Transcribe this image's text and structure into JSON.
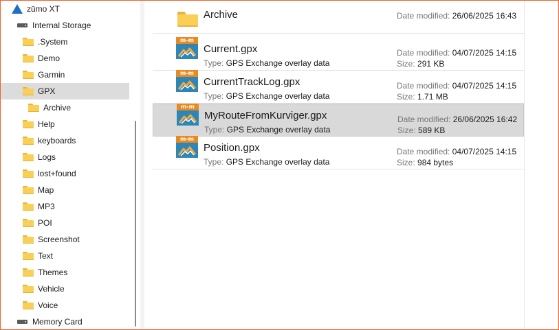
{
  "nav": {
    "device": "zūmo XT",
    "internal_storage": "Internal Storage",
    "folders": [
      ".System",
      "Demo",
      "Garmin",
      "GPX",
      "Help",
      "keyboards",
      "Logs",
      "lost+found",
      "Map",
      "MP3",
      "POI",
      "Screenshot",
      "Text",
      "Themes",
      "Vehicle",
      "Voice"
    ],
    "gpx_child": "Archive",
    "memory_card": "Memory Card",
    "selected": "GPX"
  },
  "files": [
    {
      "name": "Archive",
      "is_folder": true,
      "type_label": "",
      "type": "",
      "date_label": "Date modified:",
      "date": "26/06/2025 16:43",
      "size_label": "",
      "size": ""
    },
    {
      "name": "Current.gpx",
      "is_folder": false,
      "type_label": "Type:",
      "type": "GPS Exchange overlay data",
      "date_label": "Date modified:",
      "date": "04/07/2025 14:15",
      "size_label": "Size:",
      "size": "291 KB"
    },
    {
      "name": "CurrentTrackLog.gpx",
      "is_folder": false,
      "type_label": "Type:",
      "type": "GPS Exchange overlay data",
      "date_label": "Date modified:",
      "date": "04/07/2025 14:15",
      "size_label": "Size:",
      "size": "1.71 MB"
    },
    {
      "name": "MyRouteFromKurviger.gpx",
      "is_folder": false,
      "type_label": "Type:",
      "type": "GPS Exchange overlay data",
      "date_label": "Date modified:",
      "date": "26/06/2025 16:42",
      "size_label": "Size:",
      "size": "589 KB"
    },
    {
      "name": "Position.gpx",
      "is_folder": false,
      "type_label": "Type:",
      "type": "GPS Exchange overlay data",
      "date_label": "Date modified:",
      "date": "04/07/2025 14:15",
      "size_label": "Size:",
      "size": "984 bytes"
    }
  ],
  "gpx_icon_text": "m-m",
  "colors": {
    "accent_border": "#f0602b",
    "selection": "#d9d9d9",
    "folder": "#f9cf55",
    "gpx_icon_blue": "#2d86b8",
    "gpx_icon_orange": "#e98a1f"
  }
}
